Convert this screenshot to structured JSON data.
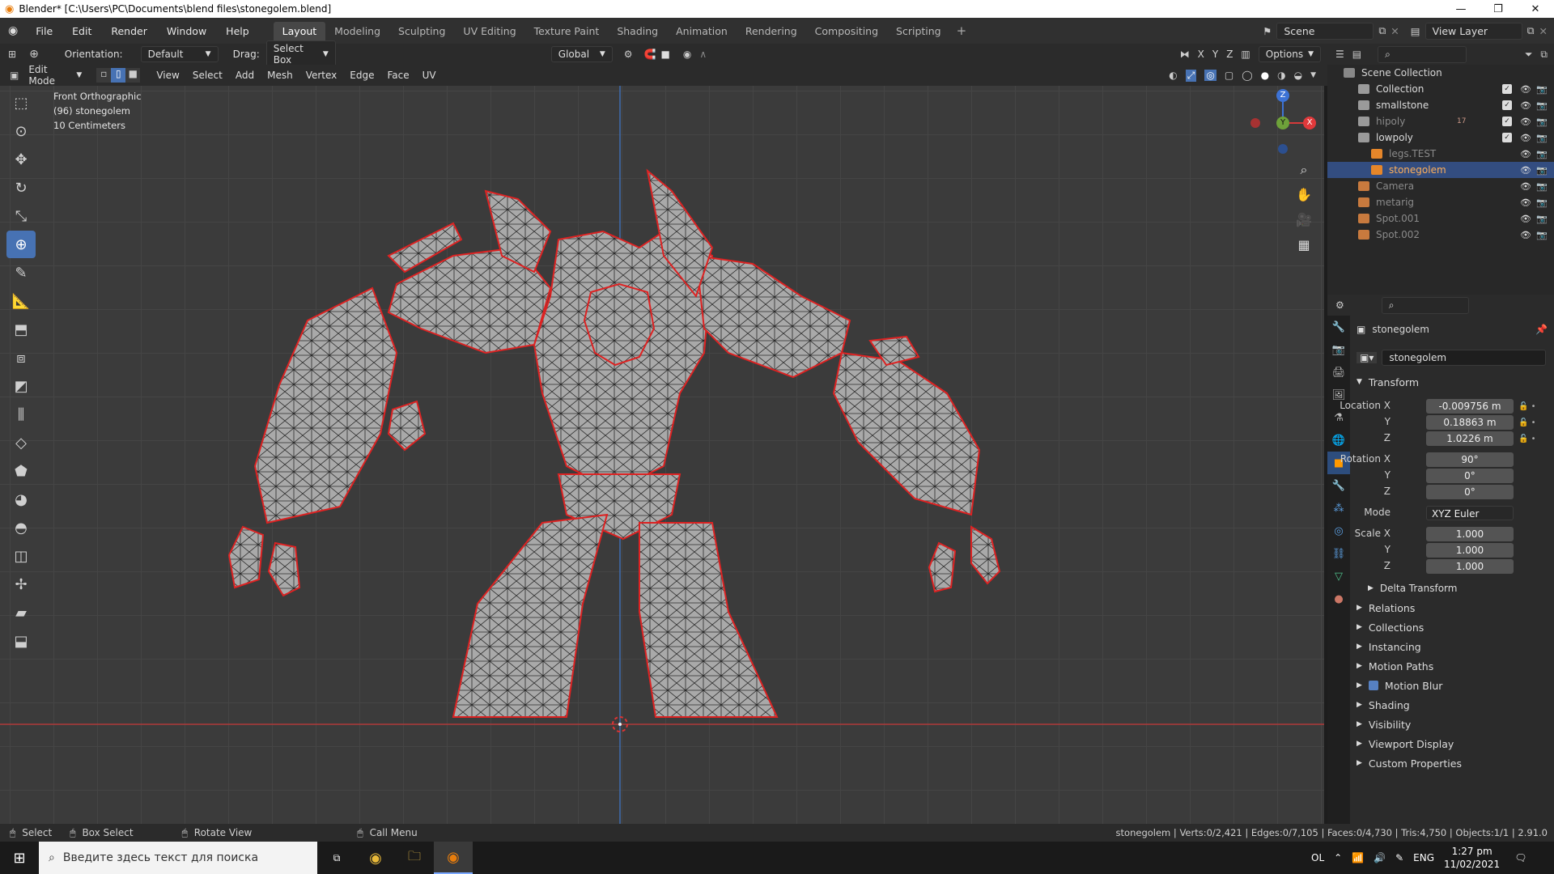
{
  "title_bar": {
    "text": "Blender* [C:\\Users\\PC\\Documents\\blend files\\stonegolem.blend]"
  },
  "menu": {
    "items": [
      "File",
      "Edit",
      "Render",
      "Window",
      "Help"
    ]
  },
  "workspaces": [
    "Layout",
    "Modeling",
    "Sculpting",
    "UV Editing",
    "Texture Paint",
    "Shading",
    "Animation",
    "Rendering",
    "Compositing",
    "Scripting"
  ],
  "active_workspace": "Layout",
  "scene": {
    "scene_name": "Scene",
    "view_layer": "View Layer"
  },
  "header": {
    "orientation_label": "Orientation:",
    "orientation_value": "Default",
    "drag_label": "Drag:",
    "drag_value": "Select Box",
    "transform_orientation": "Global",
    "axes": [
      "X",
      "Y",
      "Z"
    ],
    "options_label": "Options"
  },
  "edit_header": {
    "mode": "Edit Mode",
    "menus": [
      "View",
      "Select",
      "Add",
      "Mesh",
      "Vertex",
      "Edge",
      "Face",
      "UV"
    ]
  },
  "viewport": {
    "view_name": "Front Orthographic",
    "object_info": "(96) stonegolem",
    "scale_info": "10 Centimeters",
    "gizmo": {
      "z": "Z",
      "y": "Y",
      "x": "X"
    }
  },
  "outliner": {
    "root": "Scene Collection",
    "rows": [
      {
        "name": "Collection",
        "indent": 1,
        "type": "collection"
      },
      {
        "name": "smallstone",
        "indent": 1,
        "type": "collection"
      },
      {
        "name": "hipoly",
        "indent": 1,
        "type": "collection",
        "dim": true,
        "extra": "17"
      },
      {
        "name": "lowpoly",
        "indent": 1,
        "type": "collection"
      },
      {
        "name": "legs.TEST",
        "indent": 2,
        "type": "mesh",
        "dim": true
      },
      {
        "name": "stonegolem",
        "indent": 2,
        "type": "mesh",
        "selected": true
      },
      {
        "name": "Camera",
        "indent": 1,
        "type": "camera",
        "dim": true
      },
      {
        "name": "metarig",
        "indent": 1,
        "type": "armature",
        "dim": true
      },
      {
        "name": "Spot.001",
        "indent": 1,
        "type": "light",
        "dim": true
      },
      {
        "name": "Spot.002",
        "indent": 1,
        "type": "light",
        "dim": true
      }
    ]
  },
  "properties": {
    "object_name": "stonegolem",
    "object_field": "stonegolem",
    "transform_label": "Transform",
    "location": {
      "label": "Location X",
      "x": "-0.009756 m",
      "y": "0.18863 m",
      "z": "1.0226 m"
    },
    "rotation": {
      "label": "Rotation X",
      "x": "90°",
      "y": "0°",
      "z": "0°"
    },
    "mode": {
      "label": "Mode",
      "value": "XYZ Euler"
    },
    "scale": {
      "label": "Scale X",
      "x": "1.000",
      "y": "1.000",
      "z": "1.000"
    },
    "axis_y": "Y",
    "axis_z": "Z",
    "delta_transform": "Delta Transform",
    "panels": [
      "Relations",
      "Collections",
      "Instancing",
      "Motion Paths",
      "Motion Blur",
      "Shading",
      "Visibility",
      "Viewport Display",
      "Custom Properties"
    ]
  },
  "status_bar": {
    "select": "Select",
    "box_select": "Box Select",
    "rotate_view": "Rotate View",
    "call_menu": "Call Menu",
    "stats": "stonegolem | Verts:0/2,421 | Edges:0/7,105 | Faces:0/4,730 | Tris:4,750 | Objects:1/1 | 2.91.0"
  },
  "taskbar": {
    "search_placeholder": "Введите здесь текст для поиска",
    "tray_ol": "OL",
    "language": "ENG",
    "time": "1:27 pm",
    "date": "11/02/2021"
  },
  "colors": {
    "accent": "#4772b3",
    "selection_outline": "#e02020",
    "viewport_bg": "#3b3b3b"
  }
}
